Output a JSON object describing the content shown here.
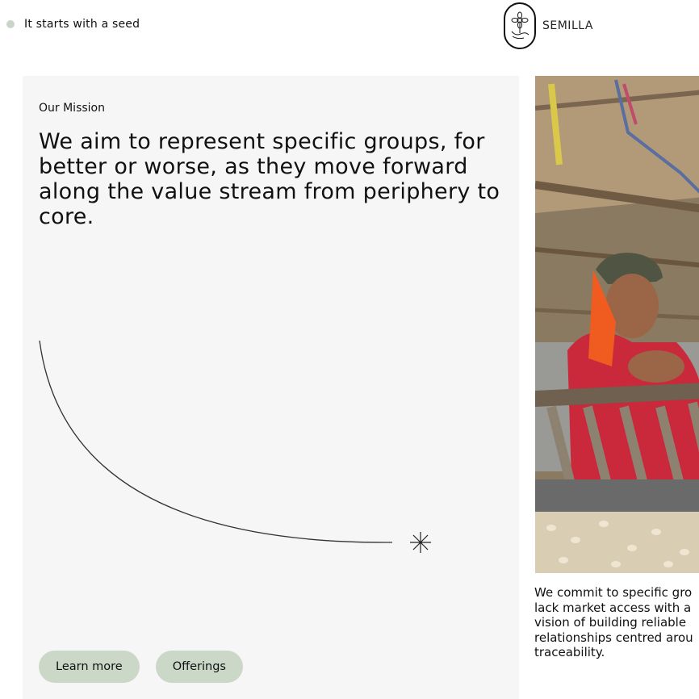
{
  "header": {
    "tagline": "It starts with a seed",
    "brand_name": "SEMILLA",
    "logo_icon": "flower-hand-logo-icon",
    "dot_color": "#c7d6c7"
  },
  "mission": {
    "eyebrow": "Our Mission",
    "headline": "We aim to represent specific groups, for better or worse, as they move forward along the value stream from periphery to core.",
    "decoration_icon": "asterisk-star-icon",
    "buttons": {
      "learn_more": "Learn more",
      "offerings": "Offerings"
    },
    "button_color": "#cbd8c8",
    "panel_color": "#f6f6f6"
  },
  "side": {
    "photo_icon": "coffee-farmer-photo",
    "commit_lines": [
      "We commit to specific gro",
      "lack market access with a",
      "vision of building reliable",
      "relationships centred arou",
      "traceability."
    ]
  }
}
